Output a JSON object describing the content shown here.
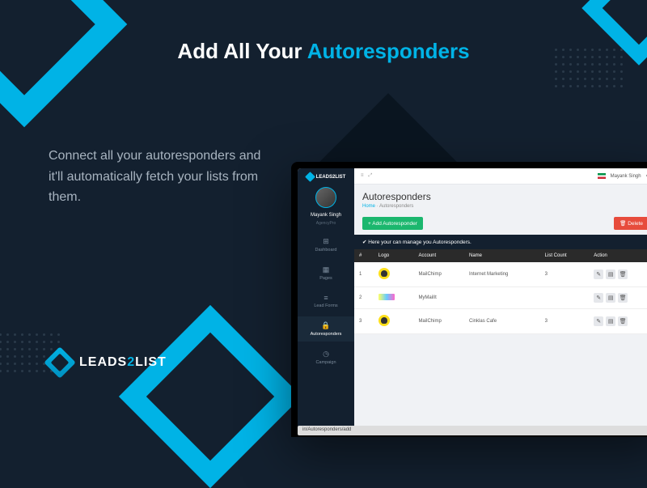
{
  "heading": {
    "prefix": "Add All Your ",
    "accent": "Autoresponders"
  },
  "body_copy": "Connect all your autoresponders and it'll automatically fetch your lists from them.",
  "brand": {
    "pre": "LEADS",
    "mid": "2",
    "post": "LIST"
  },
  "app": {
    "sidebar": {
      "logo": "LEADS2LIST",
      "user_name": "Mayank Singh",
      "user_role": "AgencyPro",
      "items": [
        {
          "icon": "⊞",
          "label": "Dashboard"
        },
        {
          "icon": "▦",
          "label": "Pages"
        },
        {
          "icon": "≡",
          "label": "Lead Forms"
        },
        {
          "icon": "🔒",
          "label": "Autoresponders"
        },
        {
          "icon": "◷",
          "label": "Campaign"
        }
      ]
    },
    "topbar": {
      "user": "Mayank Singh"
    },
    "page": {
      "title": "Autoresponders",
      "breadcrumb_home": "Home",
      "breadcrumb_current": "Autoresponders"
    },
    "buttons": {
      "add": "+ Add Autoresponder",
      "delete": "🗑 Delete"
    },
    "panel_head": "✔ Here your can manage you Autoresponders.",
    "table": {
      "headers": [
        "#",
        "Logo",
        "Account",
        "Name",
        "List Count",
        "Action"
      ],
      "rows": [
        {
          "n": "1",
          "logo": "chimp",
          "account": "MailChimp",
          "name": "Internet Marketing",
          "count": "3"
        },
        {
          "n": "2",
          "logo": "mymail",
          "account": "MyMailIt",
          "name": "",
          "count": ""
        },
        {
          "n": "3",
          "logo": "chimp",
          "account": "MailChimp",
          "name": "Cinklas Cafe",
          "count": "3"
        }
      ]
    },
    "url": "in/Autoresponders/add"
  }
}
